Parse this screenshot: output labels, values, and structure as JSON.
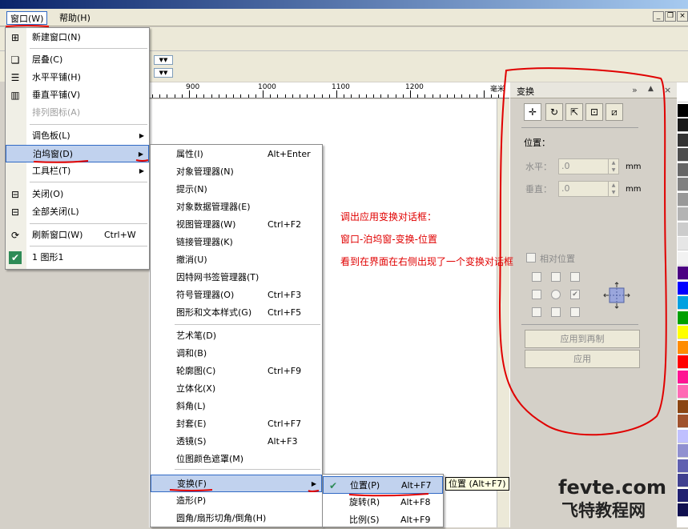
{
  "menubar": {
    "window": "窗口(W)",
    "help": "帮助(H)"
  },
  "ruler": {
    "labels": [
      "900",
      "1000",
      "1100",
      "1200"
    ],
    "unit": "毫米"
  },
  "window_menu": {
    "items": [
      {
        "label": "新建窗口(N)",
        "icon": "new-window-icon"
      },
      {
        "label": "层叠(C)",
        "icon": "cascade-icon"
      },
      {
        "label": "水平平铺(H)",
        "icon": "tile-horizontal-icon"
      },
      {
        "label": "垂直平铺(V)",
        "icon": "tile-vertical-icon"
      },
      {
        "label": "排列图标(A)",
        "disabled": true
      },
      {
        "label": "调色板(L)",
        "submenu": true
      },
      {
        "label": "泊坞窗(D)",
        "submenu": true,
        "highlighted": true
      },
      {
        "label": "工具栏(T)",
        "submenu": true
      },
      {
        "label": "关闭(O)",
        "icon": "close-window-icon"
      },
      {
        "label": "全部关闭(L)",
        "icon": "close-all-icon"
      },
      {
        "label": "刷新窗口(W)",
        "shortcut": "Ctrl+W",
        "icon": "refresh-window-icon"
      },
      {
        "label": "1 图形1",
        "icon": "check-icon"
      }
    ]
  },
  "docker_menu": {
    "items": [
      {
        "label": "属性(I)",
        "shortcut": "Alt+Enter"
      },
      {
        "label": "对象管理器(N)"
      },
      {
        "label": "提示(N)"
      },
      {
        "label": "对象数据管理器(E)"
      },
      {
        "label": "视图管理器(W)",
        "shortcut": "Ctrl+F2"
      },
      {
        "label": "链接管理器(K)"
      },
      {
        "label": "撤消(U)"
      },
      {
        "label": "因特网书签管理器(T)"
      },
      {
        "label": "符号管理器(O)",
        "shortcut": "Ctrl+F3"
      },
      {
        "label": "图形和文本样式(G)",
        "shortcut": "Ctrl+F5"
      },
      {
        "label": "艺术笔(D)"
      },
      {
        "label": "调和(B)"
      },
      {
        "label": "轮廓图(C)",
        "shortcut": "Ctrl+F9"
      },
      {
        "label": "立体化(X)"
      },
      {
        "label": "斜角(L)"
      },
      {
        "label": "封套(E)",
        "shortcut": "Ctrl+F7"
      },
      {
        "label": "透镜(S)",
        "shortcut": "Alt+F3"
      },
      {
        "label": "位图颜色遮罩(M)"
      },
      {
        "label": "变换(F)",
        "submenu": true,
        "highlighted": true
      },
      {
        "label": "造形(P)"
      },
      {
        "label": "圆角/扇形切角/倒角(H)"
      }
    ]
  },
  "transform_menu": {
    "items": [
      {
        "label": "位置(P)",
        "shortcut": "Alt+F7",
        "checked": true
      },
      {
        "label": "旋转(R)",
        "shortcut": "Alt+F8"
      },
      {
        "label": "比例(S)",
        "shortcut": "Alt+F9"
      }
    ]
  },
  "tooltip": "位置 (Alt+F7)",
  "docker_panel": {
    "title": "变换",
    "section": "位置：",
    "h_label": "水平：",
    "h_value": ".0",
    "v_label": "垂直：",
    "v_value": ".0",
    "unit": "mm",
    "relative_label": "相对位置",
    "apply_copy": "应用到再制",
    "apply": "应用"
  },
  "annotation": {
    "line1": "调出应用变换对话框：",
    "line2": "窗口-泊坞窗-变换-位置",
    "line3": "看到在界面在右侧出现了一个变换对话框"
  },
  "watermark": {
    "site": "fevte.com",
    "name": "飞特教程网"
  },
  "palette_colors": [
    "#ffffff",
    "#000000",
    "#1a1a1a",
    "#333333",
    "#4d4d4d",
    "#666666",
    "#808080",
    "#999999",
    "#b3b3b3",
    "#cccccc",
    "#e6e6e6",
    "#f2f2f2",
    "#4b0082",
    "#0000ff",
    "#00a0e0",
    "#00a000",
    "#ffff00",
    "#ff8c00",
    "#ff0000",
    "#ff1493",
    "#ff69b4",
    "#8b4513",
    "#a0522d",
    "#c0c0ff",
    "#9090d0",
    "#6060b0",
    "#404090",
    "#202070",
    "#101050"
  ]
}
